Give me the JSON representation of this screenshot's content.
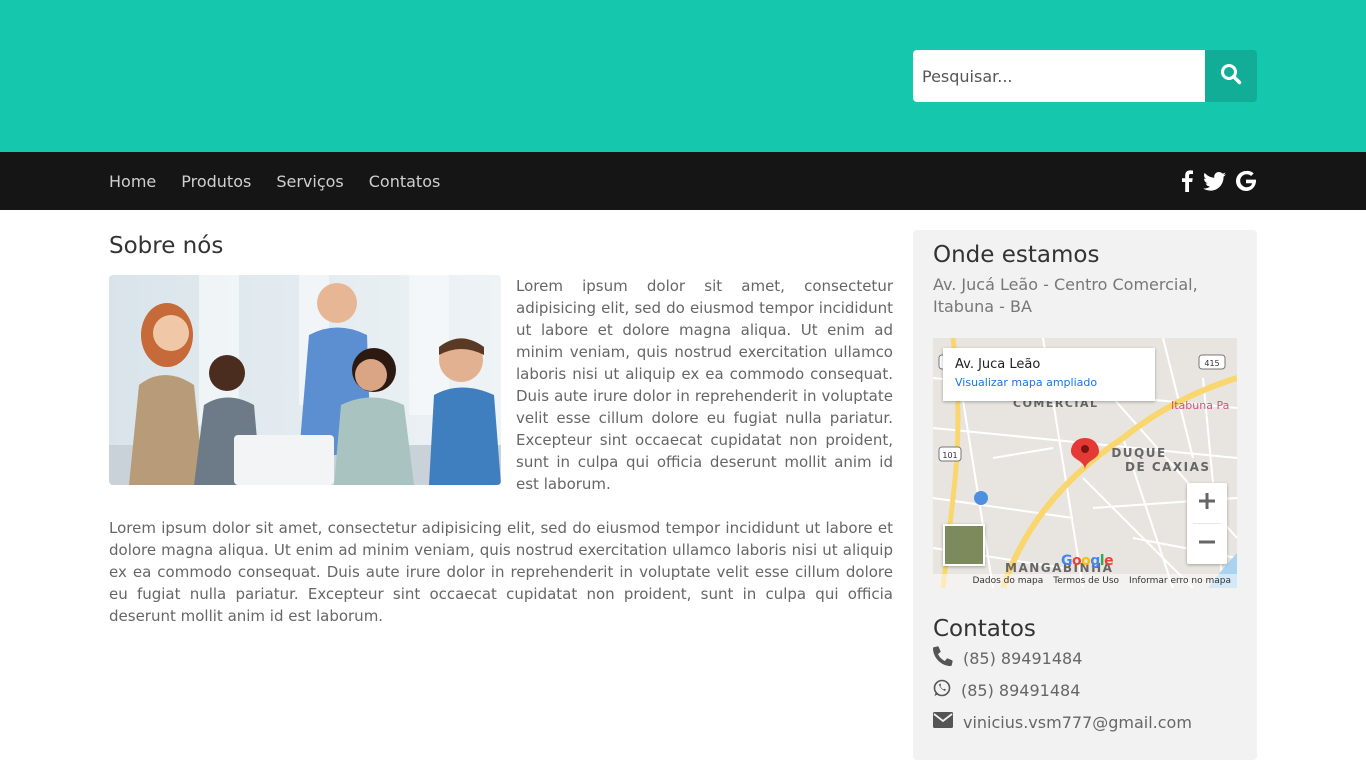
{
  "search": {
    "placeholder": "Pesquisar..."
  },
  "nav": {
    "items": [
      "Home",
      "Produtos",
      "Serviços",
      "Contatos"
    ]
  },
  "social": [
    "facebook-icon",
    "twitter-icon",
    "google-icon"
  ],
  "about": {
    "title": "Sobre nós",
    "paragraph1": "Lorem ipsum dolor sit amet, consectetur adipisicing elit, sed do eiusmod tempor incididunt ut labore et dolore magna aliqua. Ut enim ad minim veniam, quis nostrud exercitation ullamco laboris nisi ut aliquip ex ea commodo consequat. Duis aute irure dolor in reprehenderit in voluptate velit esse cillum dolore eu fugiat nulla pariatur. Excepteur sint occaecat cupidatat non proident, sunt in culpa qui officia deserunt mollit anim id est laborum.",
    "paragraph2": "Lorem ipsum dolor sit amet, consectetur adipisicing elit, sed do eiusmod tempor incididunt ut labore et dolore magna aliqua. Ut enim ad minim veniam, quis nostrud exercitation ullamco laboris nisi ut aliquip ex ea commodo consequat. Duis aute irure dolor in reprehenderit in voluptate velit esse cillum dolore eu fugiat nulla pariatur. Excepteur sint occaecat cupidatat non proident, sunt in culpa qui officia deserunt mollit anim id est laborum."
  },
  "location": {
    "title": "Onde estamos",
    "address": "Av. Jucá Leão - Centro Comercial, Itabuna - BA",
    "map": {
      "card_title": "Av. Juca Leão",
      "card_link": "Visualizar mapa ampliado",
      "labels": {
        "duque": "DUQUE",
        "caxias": "DE CAXIAS",
        "comercial": "COMERCIAL",
        "mangabinha": "MANGABINHA",
        "itabuna": "Itabuna Pa",
        "road_415": "415",
        "road_101": "101"
      },
      "footer": [
        "Dados do mapa",
        "Termos de Uso",
        "Informar erro no mapa"
      ],
      "logo": "Google"
    }
  },
  "contacts": {
    "title": "Contatos",
    "phone": "(85) 89491484",
    "whatsapp": "(85) 89491484",
    "email": "vinicius.vsm777@gmail.com"
  },
  "colors": {
    "header": "#15c7ac",
    "navbar": "#151515",
    "search_button": "#12ad96"
  }
}
